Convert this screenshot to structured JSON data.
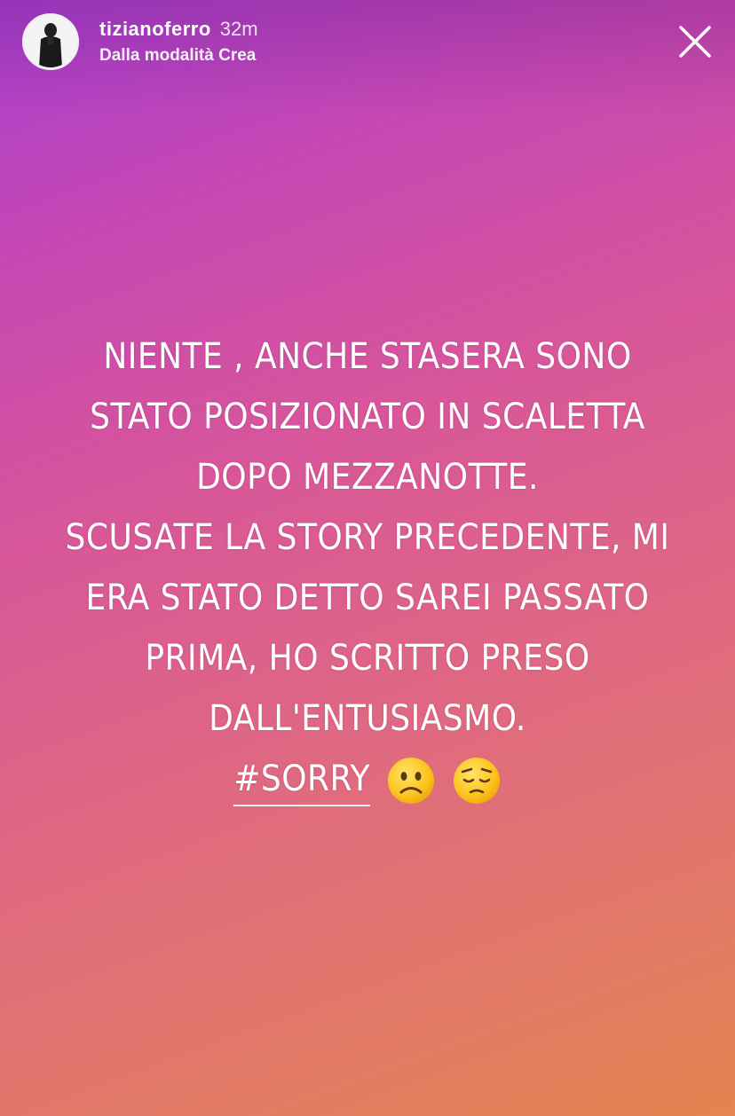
{
  "header": {
    "username": "tizianoferro",
    "time_ago": "32m",
    "subtitle": "Dalla modalità Crea"
  },
  "icons": {
    "avatar": "profile-photo",
    "close": "close-icon",
    "emoji_1": "slightly-frowning-face",
    "emoji_2": "pensive-face"
  },
  "story": {
    "lines": [
      "NIENTE , ANCHE STASERA SONO",
      "STATO POSIZIONATO IN SCALETTA",
      "DOPO MEZZANOTTE.",
      "SCUSATE LA STORY PRECEDENTE, MI",
      "ERA STATO DETTO SAREI PASSATO",
      "PRIMA, HO SCRITTO PRESO",
      "DALL'ENTUSIASMO."
    ],
    "hashtag": "#SORRY"
  },
  "colors": {
    "gradient_top": "#a83fd0",
    "gradient_middle": "#d8569a",
    "gradient_bottom": "#e4844f",
    "text": "#ffffff"
  }
}
